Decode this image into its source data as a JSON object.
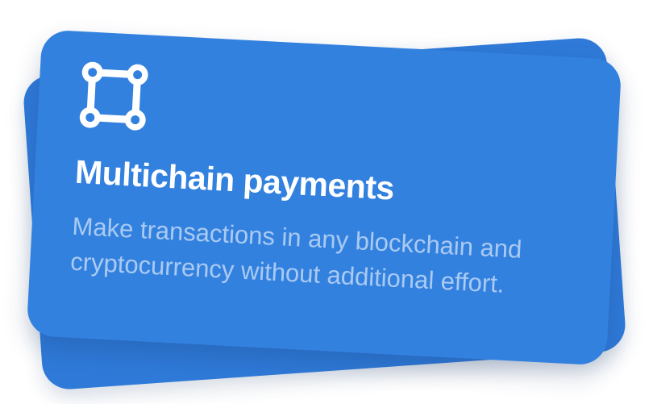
{
  "card": {
    "icon": "nodes-chain-icon",
    "title": "Multichain payments",
    "description": "Make transactions in any blockchain and cryptocurrency without additional effort."
  },
  "colors": {
    "card_front": "#3381df",
    "card_back": "#2f7ad8",
    "text_primary": "#ffffff",
    "text_secondary": "#a9c9f1"
  }
}
